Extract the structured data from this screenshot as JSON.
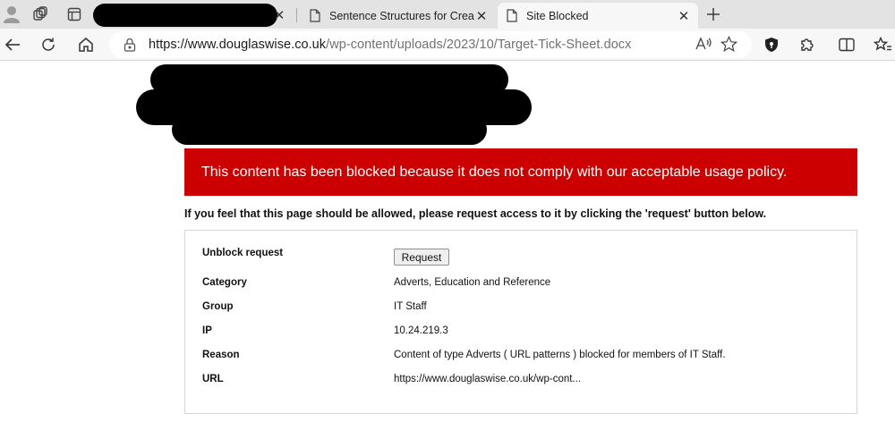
{
  "browser": {
    "tabs": [
      {
        "title": "",
        "redacted": true
      },
      {
        "title": "Sentence Structures for Creative Writing"
      },
      {
        "title": "Site Blocked",
        "active": true
      }
    ],
    "address_bar": {
      "url_host": "https://www.douglaswise.co.uk",
      "url_path": "/wp-content/uploads/2023/10/Target-Tick-Sheet.docx"
    }
  },
  "page": {
    "banner_text": "This content has been blocked because it does not comply with our acceptable usage policy.",
    "banner_color": "#cc0000",
    "notice": "If you feel that this page should be allowed, please request access to it by clicking the 'request' button below.",
    "info": {
      "unblock_label": "Unblock request",
      "request_button": "Request",
      "rows": [
        {
          "label": "Category",
          "value": "Adverts, Education and Reference"
        },
        {
          "label": "Group",
          "value": "IT Staff"
        },
        {
          "label": "IP",
          "value": "10.24.219.3"
        },
        {
          "label": "Reason",
          "value": "Content of type Adverts ( URL patterns ) blocked for members of IT Staff."
        },
        {
          "label": "URL",
          "value": "https://www.douglaswise.co.uk/wp-cont..."
        }
      ]
    }
  }
}
